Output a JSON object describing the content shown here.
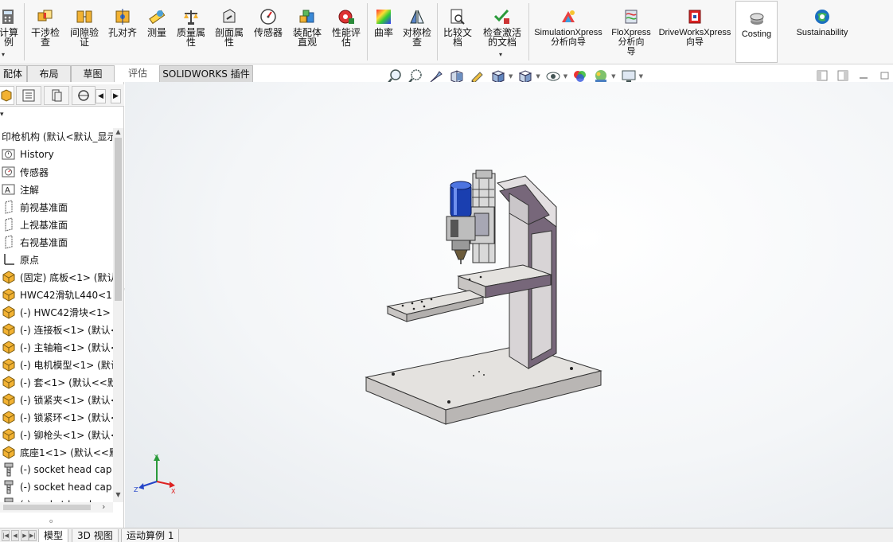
{
  "ribbon": {
    "buttons": [
      {
        "label": "计算\n例",
        "icon": "calculator-icon"
      },
      {
        "label": "干涉检\n查",
        "icon": "interference-check-icon"
      },
      {
        "label": "间隙验\n证",
        "icon": "clearance-verification-icon"
      },
      {
        "label": "孔对齐",
        "icon": "hole-alignment-icon"
      },
      {
        "label": "测量",
        "icon": "measure-icon"
      },
      {
        "label": "质量属\n性",
        "icon": "mass-properties-icon"
      },
      {
        "label": "剖面属\n性",
        "icon": "section-properties-icon"
      },
      {
        "label": "传感器",
        "icon": "sensor-icon"
      },
      {
        "label": "装配体\n直观",
        "icon": "assembly-visualization-icon"
      },
      {
        "label": "性能评\n估",
        "icon": "performance-evaluation-icon"
      },
      {
        "label": "曲率",
        "icon": "curvature-icon"
      },
      {
        "label": "对称检\n查",
        "icon": "symmetry-check-icon"
      },
      {
        "label": "比较文\n档",
        "icon": "compare-documents-icon"
      },
      {
        "label": "检查激活\n的文档",
        "icon": "check-active-document-icon"
      },
      {
        "label": "SimulationXpress\n分析向导",
        "icon": "simulationxpress-icon"
      },
      {
        "label": "FloXpress\n分析向\n导",
        "icon": "floxpress-icon"
      },
      {
        "label": "DriveWorksXpress\n向导",
        "icon": "driveworksxpress-icon"
      },
      {
        "label": "Costing",
        "icon": "costing-icon"
      },
      {
        "label": "Sustainability",
        "icon": "sustainability-icon"
      }
    ]
  },
  "tabs": {
    "items": [
      "配体",
      "布局",
      "草图",
      "评估",
      "SOLIDWORKS 插件"
    ],
    "active": "评估"
  },
  "feature_tree": {
    "root": "印枪机构 (默认<默认_显示",
    "items": [
      {
        "label": "History",
        "icon": "history-folder-icon"
      },
      {
        "label": "传感器",
        "icon": "sensor-folder-icon"
      },
      {
        "label": "注解",
        "icon": "annotation-icon"
      },
      {
        "label": "前视基准面",
        "icon": "plane-icon"
      },
      {
        "label": "上视基准面",
        "icon": "plane-icon"
      },
      {
        "label": "右视基准面",
        "icon": "plane-icon"
      },
      {
        "label": "原点",
        "icon": "origin-icon"
      },
      {
        "label": "(固定) 底板<1> (默认",
        "icon": "part-icon"
      },
      {
        "label": "HWC42滑轨L440<1>",
        "icon": "part-icon"
      },
      {
        "label": "(-) HWC42滑块<1> (",
        "icon": "part-icon"
      },
      {
        "label": "(-) 连接板<1> (默认<",
        "icon": "part-icon"
      },
      {
        "label": "(-) 主轴箱<1> (默认<",
        "icon": "part-icon"
      },
      {
        "label": "(-) 电机模型<1> (默认",
        "icon": "part-icon"
      },
      {
        "label": "(-) 套<1> (默认<<默",
        "icon": "part-icon"
      },
      {
        "label": "(-) 锁紧夹<1> (默认<",
        "icon": "part-icon"
      },
      {
        "label": "(-) 锁紧环<1> (默认<",
        "icon": "part-icon"
      },
      {
        "label": "(-) 铆枪头<1> (默认<",
        "icon": "part-icon"
      },
      {
        "label": "底座1<1> (默认<<默",
        "icon": "part-icon"
      },
      {
        "label": "(-) socket head cap",
        "icon": "screw-icon"
      },
      {
        "label": "(-) socket head cap",
        "icon": "screw-icon"
      },
      {
        "label": "(-) socket head cap",
        "icon": "screw-icon"
      }
    ]
  },
  "triad": {
    "x": "X",
    "y": "Y",
    "z": "Z"
  },
  "bottom_tabs": {
    "items": [
      "模型",
      "3D 视图",
      "运动算例 1"
    ],
    "active": "模型"
  },
  "colors": {
    "frame_face": "#d8d4d6",
    "frame_side": "#77677a",
    "motor_blue": "#1a3fb0",
    "viewport_bg": "#f4f6f8"
  }
}
